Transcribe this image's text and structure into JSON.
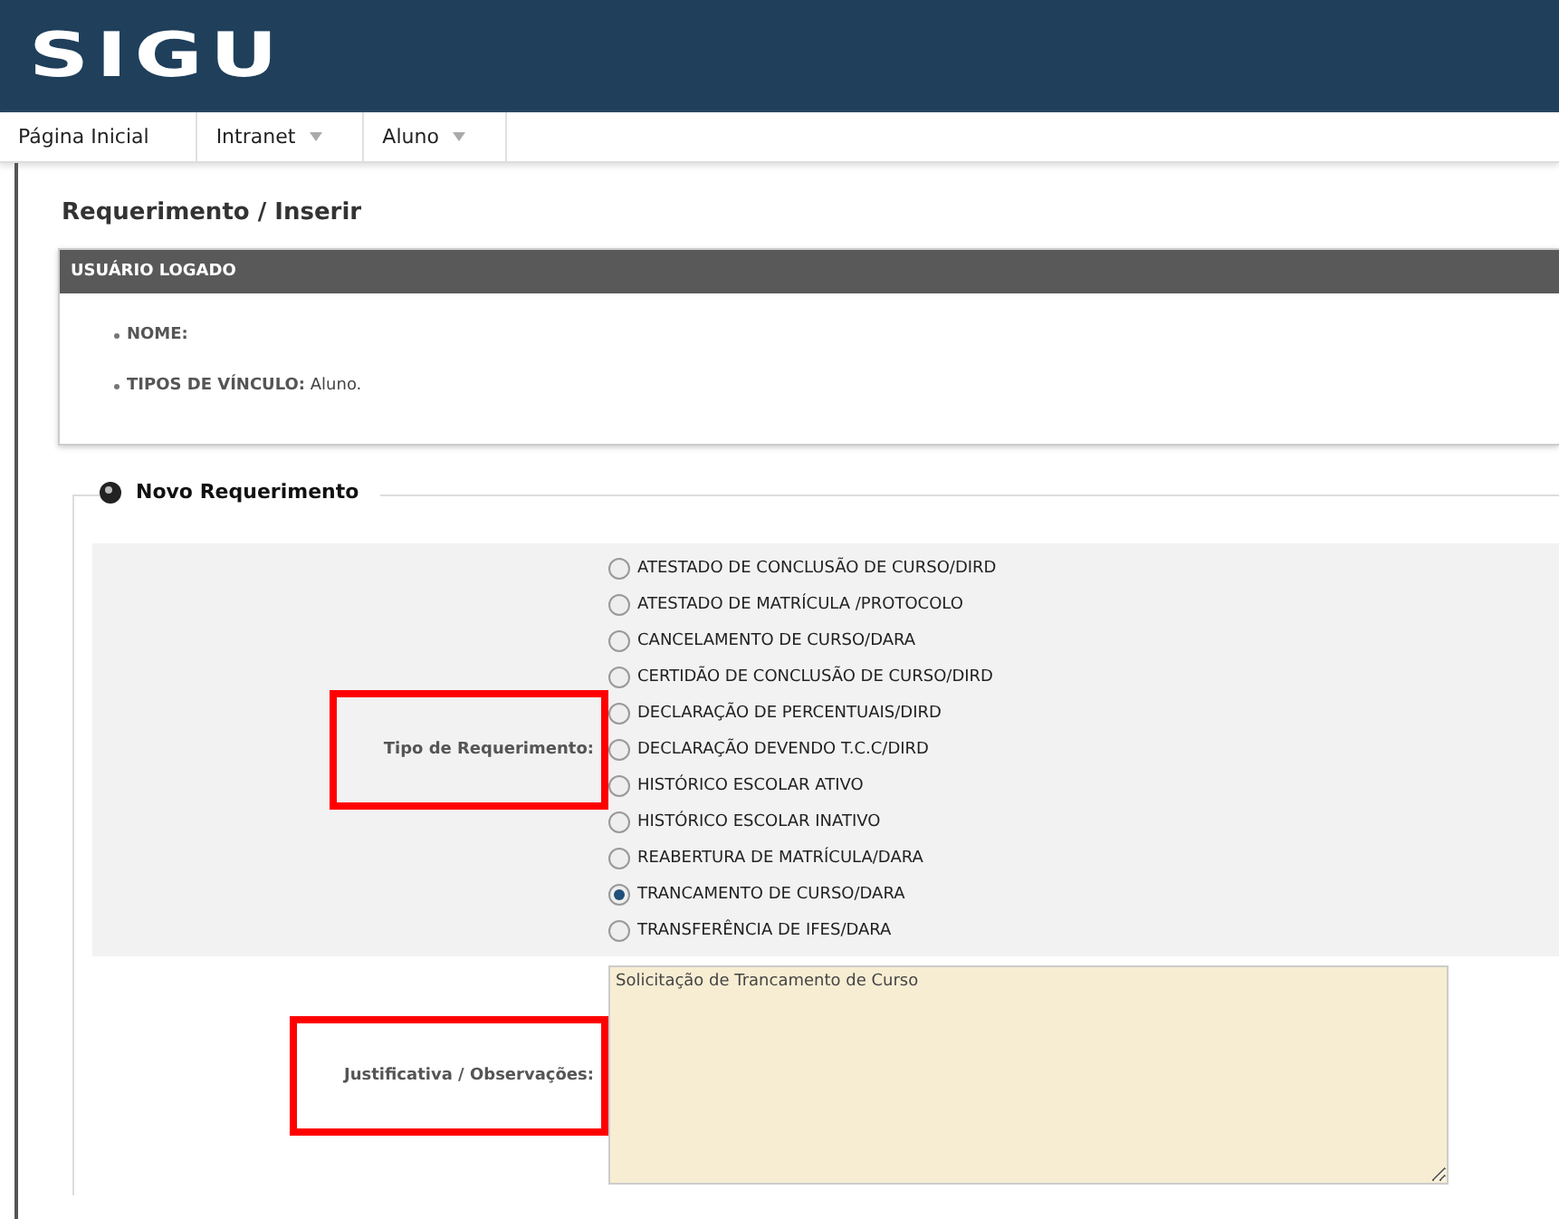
{
  "header": {
    "logo": "SIGU"
  },
  "menu": [
    {
      "label": "Página Inicial",
      "dropdown": false
    },
    {
      "label": "Intranet",
      "dropdown": true
    },
    {
      "label": "Aluno",
      "dropdown": true
    }
  ],
  "page_title": "Requerimento / Inserir",
  "user_panel": {
    "title": "USUÁRIO LOGADO",
    "fields": [
      {
        "label": "NOME:"
      },
      {
        "label": "TIPOS DE VÍNCULO:",
        "value": "Aluno."
      }
    ]
  },
  "form": {
    "legend": "Novo Requerimento",
    "type_label": "Tipo de Requerimento:",
    "type_highlighted": true,
    "options": [
      {
        "label": "ATESTADO DE CONCLUSÃO DE CURSO/DIRD",
        "selected": false
      },
      {
        "label": "ATESTADO DE MATRÍCULA /PROTOCOLO",
        "selected": false
      },
      {
        "label": "CANCELAMENTO DE CURSO/DARA",
        "selected": false
      },
      {
        "label": "CERTIDÃO DE CONCLUSÃO DE CURSO/DIRD",
        "selected": false
      },
      {
        "label": "DECLARAÇÃO DE PERCENTUAIS/DIRD",
        "selected": false
      },
      {
        "label": "DECLARAÇÃO DEVENDO T.C.C/DIRD",
        "selected": false
      },
      {
        "label": "HISTÓRICO ESCOLAR ATIVO",
        "selected": false
      },
      {
        "label": "HISTÓRICO ESCOLAR INATIVO",
        "selected": false
      },
      {
        "label": "REABERTURA DE MATRÍCULA/DARA",
        "selected": false
      },
      {
        "label": "TRANCAMENTO DE CURSO/DARA",
        "selected": true
      },
      {
        "label": "TRANSFERÊNCIA DE IFES/DARA",
        "selected": false
      }
    ],
    "notes_label": "Justificativa / Observações:",
    "notes_highlighted": true,
    "notes_value": "Solicitação de Trancamento de Curso"
  }
}
